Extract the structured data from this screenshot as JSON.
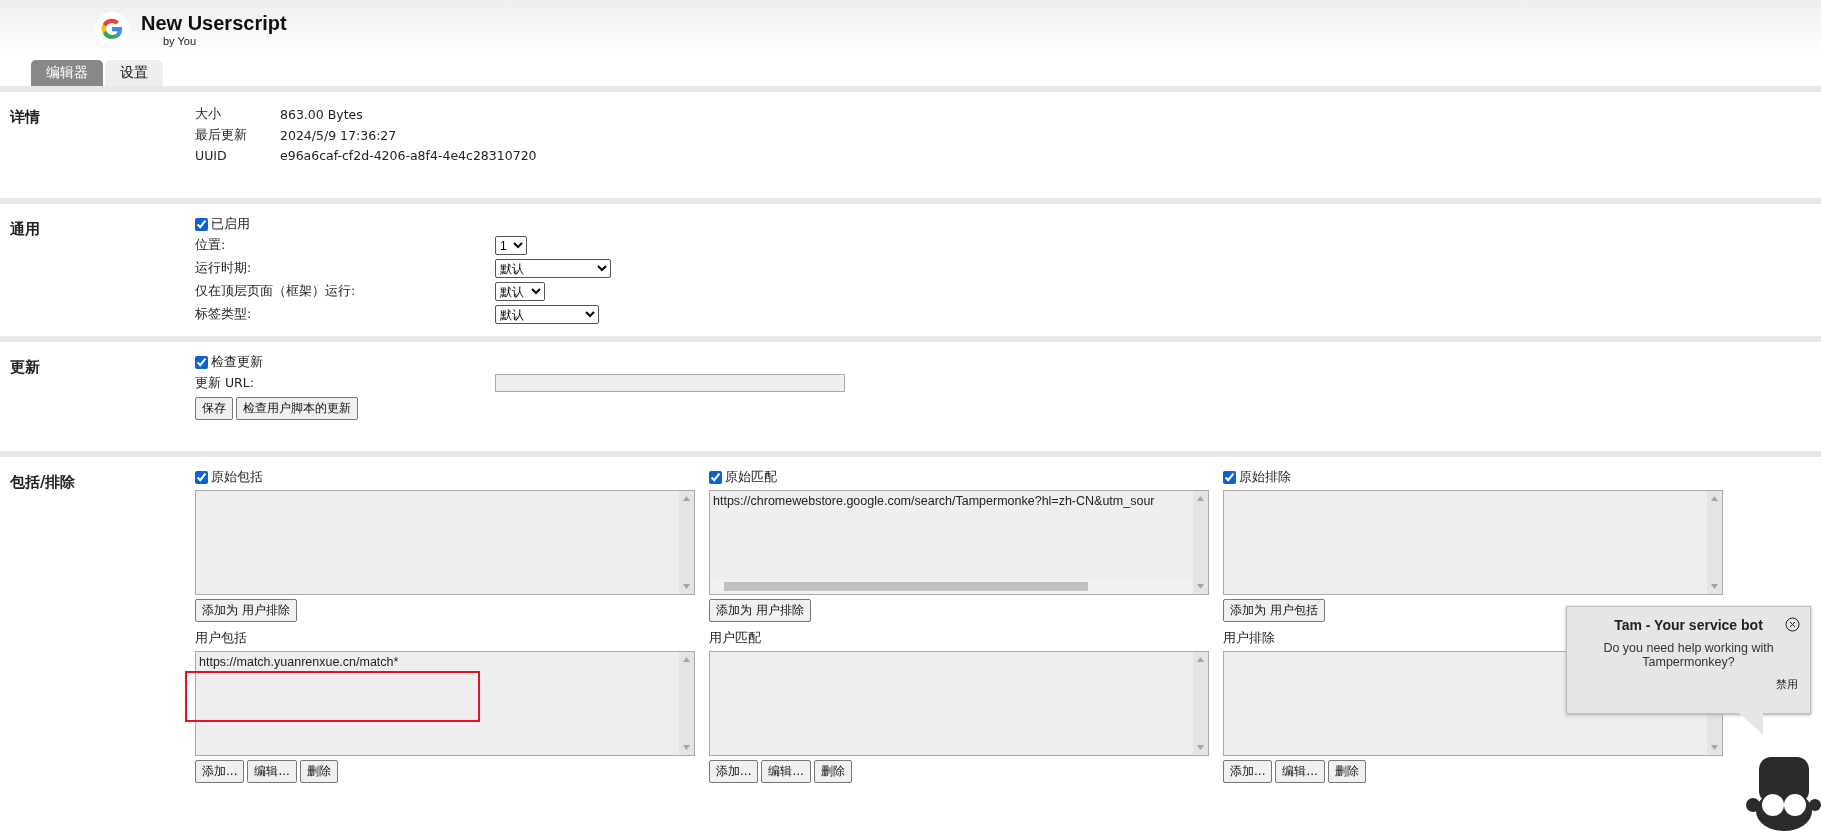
{
  "header": {
    "title": "New Userscript",
    "author": "by You"
  },
  "tabs": [
    {
      "label": "编辑器",
      "selected": true
    },
    {
      "label": "设置",
      "selected": false
    }
  ],
  "details": {
    "heading": "详情",
    "rows": [
      {
        "label": "大小",
        "value": "863.00 Bytes"
      },
      {
        "label": "最后更新",
        "value": "2024/5/9 17:36:27"
      },
      {
        "label": "UUID",
        "value": "e96a6caf-cf2d-4206-a8f4-4e4c28310720"
      }
    ]
  },
  "general": {
    "heading": "通用",
    "enabled": {
      "label": "已启用",
      "checked": true
    },
    "settings": [
      {
        "label": "位置:",
        "value": "1"
      },
      {
        "label": "运行时期:",
        "value": "默认"
      },
      {
        "label": "仅在顶层页面（框架）运行:",
        "value": "默认"
      },
      {
        "label": "标签类型:",
        "value": "默认"
      }
    ]
  },
  "update": {
    "heading": "更新",
    "check": {
      "label": "检查更新",
      "checked": true
    },
    "url_label": "更新 URL:",
    "buttons": [
      "保存",
      "检查用户脚本的更新"
    ]
  },
  "include_exclude": {
    "heading": "包括/排除",
    "columns": [
      {
        "original": {
          "label": "原始包括",
          "checked": true,
          "button": "添加为 用户排除"
        },
        "user": {
          "label": "用户包括",
          "value": "https://match.yuanrenxue.cn/match*",
          "buttons": [
            "添加...",
            "编辑...",
            "删除"
          ]
        }
      },
      {
        "original": {
          "label": "原始匹配",
          "checked": true,
          "value": "https://chromewebstore.google.com/search/Tampermonke?hl=zh-CN&utm_sour",
          "scrollbar": true,
          "button": "添加为 用户排除"
        },
        "user": {
          "label": "用户匹配",
          "buttons": [
            "添加...",
            "编辑...",
            "删除"
          ]
        }
      },
      {
        "original": {
          "label": "原始排除",
          "checked": true,
          "button": "添加为 用户包括"
        },
        "user": {
          "label": "用户排除",
          "buttons": [
            "添加...",
            "编辑...",
            "删除"
          ]
        }
      }
    ]
  },
  "annotation": {
    "kind": "rectangle"
  },
  "bot": {
    "title": "Tam - Your service bot",
    "message": "Do you need help working with Tampermonkey?",
    "disable": "禁用"
  }
}
